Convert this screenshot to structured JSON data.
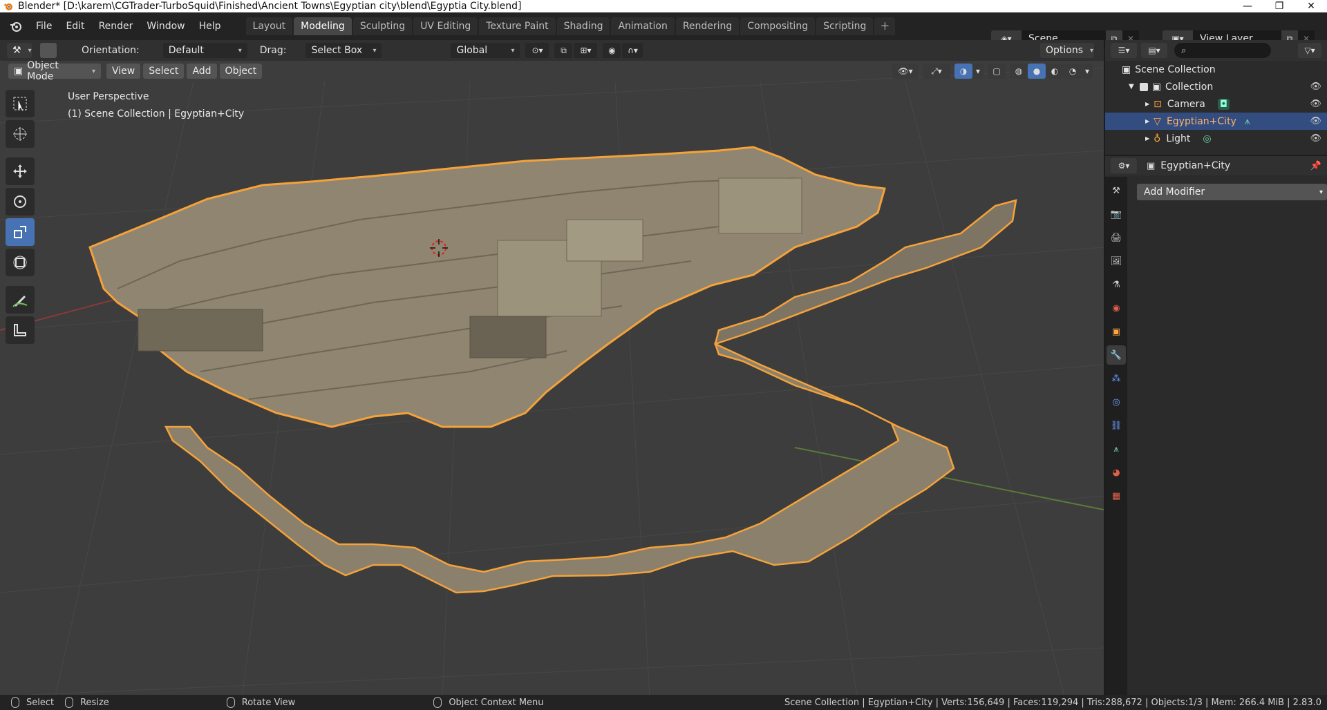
{
  "titlebar": {
    "title": "Blender* [D:\\karem\\CGTrader-TurboSquid\\Finished\\Ancient Towns\\Egyptian city\\blend\\Egyptia City.blend]",
    "minimize_icon": "minimize-icon",
    "restore_icon": "restore-icon",
    "close_icon": "close-icon"
  },
  "menu": [
    "File",
    "Edit",
    "Render",
    "Window",
    "Help"
  ],
  "workspaces": [
    "Layout",
    "Modeling",
    "Sculpting",
    "UV Editing",
    "Texture Paint",
    "Shading",
    "Animation",
    "Rendering",
    "Compositing",
    "Scripting"
  ],
  "active_workspace": "Modeling",
  "scene": {
    "label": "Scene"
  },
  "view_layer": {
    "label": "View Layer"
  },
  "tool_header": {
    "orientation_label": "Orientation:",
    "orientation_value": "Default",
    "drag_label": "Drag:",
    "drag_value": "Select Box",
    "transform_orientation": "Global",
    "options": "Options"
  },
  "viewport_header": {
    "mode": "Object Mode",
    "menus": [
      "View",
      "Select",
      "Add",
      "Object"
    ]
  },
  "viewport": {
    "perspective": "User Perspective",
    "context": "(1) Scene Collection | Egyptian+City"
  },
  "outliner": {
    "scene_collection": "Scene Collection",
    "collection": "Collection",
    "objects": [
      {
        "name": "Camera",
        "type": "camera-icon"
      },
      {
        "name": "Egyptian+City",
        "type": "mesh-icon",
        "selected": true
      },
      {
        "name": "Light",
        "type": "light-icon"
      }
    ]
  },
  "properties": {
    "object_name": "Egyptian+City",
    "add_modifier": "Add Modifier",
    "active_tab": "modifier"
  },
  "statusbar": {
    "select": "Select",
    "resize": "Resize",
    "rotate": "Rotate View",
    "context_menu": "Object Context Menu",
    "stats": "Scene Collection | Egyptian+City | Verts:156,649 | Faces:119,294 | Tris:288,672 | Objects:1/3 | Mem: 266.4 MiB | 2.83.0"
  },
  "colors": {
    "accent": "#4772b3",
    "selection_outline": "#f5a23a",
    "viewport_bg": "#3d3d3d",
    "model": "#8f8570"
  }
}
